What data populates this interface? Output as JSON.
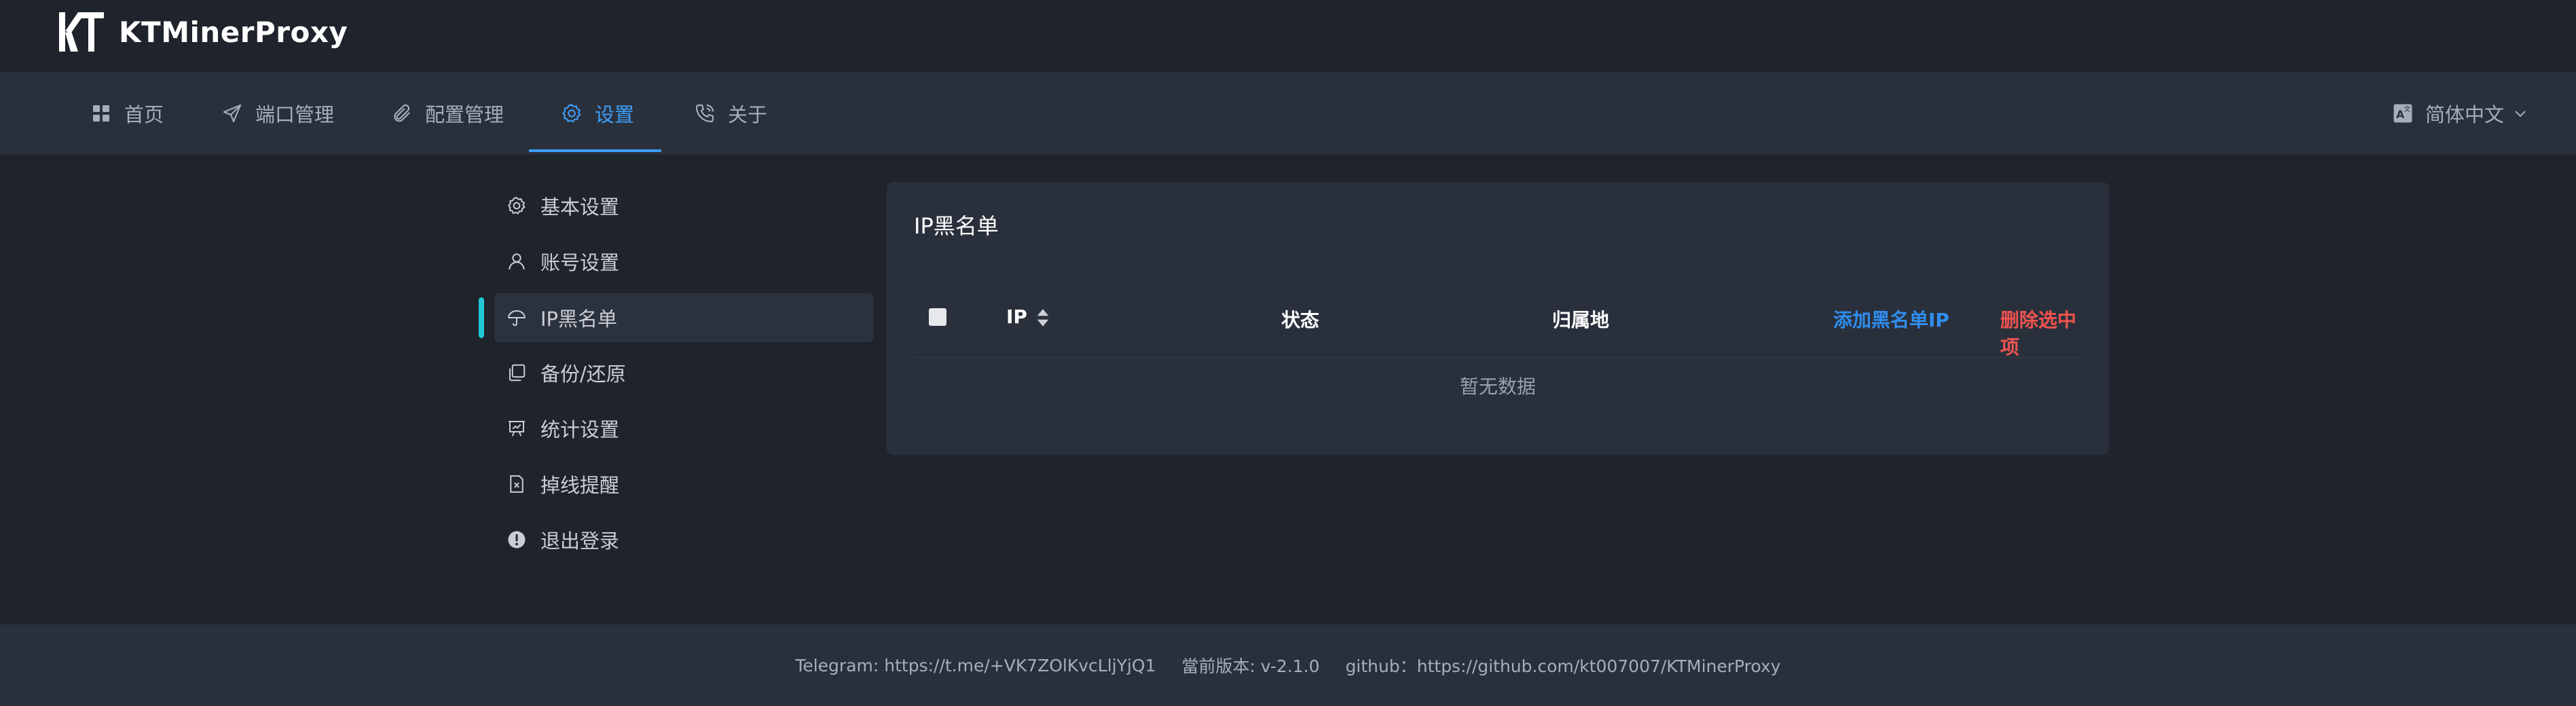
{
  "app": {
    "title": "KTMinerProxy"
  },
  "nav": {
    "items": [
      {
        "label": "首页",
        "icon": "grid-icon"
      },
      {
        "label": "端口管理",
        "icon": "send-icon"
      },
      {
        "label": "配置管理",
        "icon": "paperclip-icon"
      },
      {
        "label": "设置",
        "icon": "gear-icon",
        "active": true
      },
      {
        "label": "关于",
        "icon": "phone-icon"
      }
    ],
    "language": "简体中文"
  },
  "sidebar": {
    "items": [
      {
        "label": "基本设置",
        "icon": "gear-icon"
      },
      {
        "label": "账号设置",
        "icon": "user-icon"
      },
      {
        "label": "IP黑名单",
        "icon": "umbrella-icon",
        "active": true
      },
      {
        "label": "备份/还原",
        "icon": "copy-icon"
      },
      {
        "label": "统计设置",
        "icon": "presentation-icon"
      },
      {
        "label": "掉线提醒",
        "icon": "file-icon"
      },
      {
        "label": "退出登录",
        "icon": "exclamation-circle-icon"
      }
    ]
  },
  "panel": {
    "title": "IP黑名单",
    "columns": [
      "IP",
      "状态",
      "归属地"
    ],
    "add_label": "添加黑名单IP",
    "delete_label": "删除选中项",
    "empty_text": "暂无数据"
  },
  "footer": {
    "telegram": "Telegram: https://t.me/+VK7ZOlKvcLljYjQ1",
    "version": "當前版本: v-2.1.0",
    "github": "github：https://github.com/kt007007/KTMinerProxy"
  },
  "colors": {
    "accent": "#3d9cf5",
    "danger": "#f0534f",
    "active_marker": "#22c7d6",
    "background": "#1e232c",
    "panel": "#2a303b"
  }
}
